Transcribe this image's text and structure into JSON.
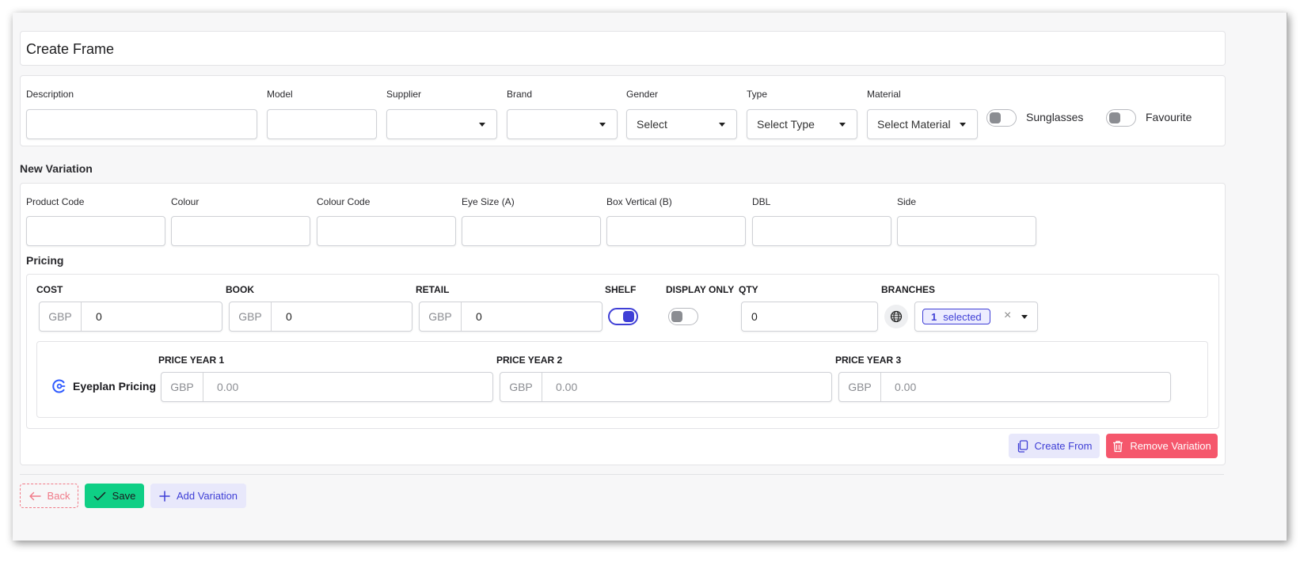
{
  "page": {
    "title": "Create Frame"
  },
  "frame_form": {
    "fields": {
      "description": {
        "label": "Description",
        "value": ""
      },
      "model": {
        "label": "Model",
        "value": ""
      },
      "supplier": {
        "label": "Supplier",
        "value": ""
      },
      "brand": {
        "label": "Brand",
        "value": ""
      },
      "gender": {
        "label": "Gender",
        "value": "Select"
      },
      "type": {
        "label": "Type",
        "value": "Select Type"
      },
      "material": {
        "label": "Material",
        "value": "Select Material"
      }
    },
    "toggles": {
      "sunglasses": {
        "label": "Sunglasses",
        "on": false
      },
      "favourite": {
        "label": "Favourite",
        "on": false
      }
    }
  },
  "variation": {
    "heading": "New Variation",
    "fields": {
      "product_code": {
        "label": "Product Code",
        "value": ""
      },
      "colour": {
        "label": "Colour",
        "value": ""
      },
      "colour_code": {
        "label": "Colour Code",
        "value": ""
      },
      "eye_size": {
        "label": "Eye Size (A)",
        "value": ""
      },
      "box_vertical": {
        "label": "Box Vertical (B)",
        "value": ""
      },
      "dbl": {
        "label": "DBL",
        "value": ""
      },
      "side": {
        "label": "Side",
        "value": ""
      }
    },
    "pricing": {
      "heading": "Pricing",
      "cost": {
        "label": "COST",
        "currency": "GBP",
        "value": "0"
      },
      "book": {
        "label": "BOOK",
        "currency": "GBP",
        "value": "0"
      },
      "retail": {
        "label": "RETAIL",
        "currency": "GBP",
        "value": "0"
      },
      "shelf": {
        "label": "SHELF",
        "on": true
      },
      "display_only": {
        "label": "DISPLAY ONLY",
        "on": false
      },
      "qty": {
        "label": "QTY",
        "value": "0"
      },
      "branches": {
        "label": "BRANCHES",
        "count": "1",
        "selected_text": "selected",
        "clear": "×"
      }
    },
    "eyeplan": {
      "label": "Eyeplan Pricing",
      "year1": {
        "label": "PRICE YEAR 1",
        "currency": "GBP",
        "placeholder": "0.00"
      },
      "year2": {
        "label": "PRICE YEAR 2",
        "currency": "GBP",
        "placeholder": "0.00"
      },
      "year3": {
        "label": "PRICE YEAR 3",
        "currency": "GBP",
        "placeholder": "0.00"
      }
    },
    "actions": {
      "create_from": "Create From",
      "remove_variation": "Remove Variation"
    }
  },
  "footer": {
    "back": "Back",
    "save": "Save",
    "add_variation": "Add Variation"
  },
  "colors": {
    "primary": "#3f3fd6",
    "success": "#0fcf85",
    "danger": "#f5576c",
    "back_border": "#f07a88"
  }
}
